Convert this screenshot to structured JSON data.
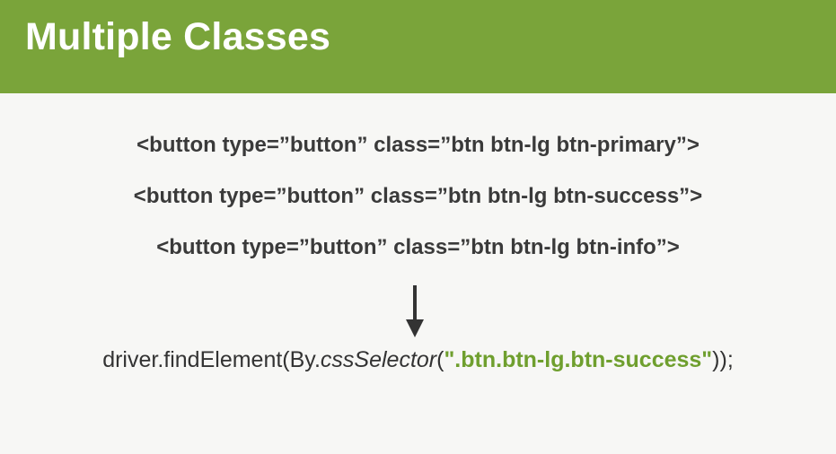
{
  "header": {
    "title": "Multiple Classes",
    "background_color": "#7aa43a"
  },
  "code_lines": [
    "<button type=”button” class=”btn btn-lg btn-primary”>",
    "<button type=”button” class=”btn btn-lg btn-success”>",
    "<button type=”button” class=”btn btn-lg btn-info”>"
  ],
  "arrow": {
    "icon": "down-arrow-icon"
  },
  "selector": {
    "prefix": "driver.findElement(By.",
    "method": "cssSelector",
    "open_paren": "(",
    "value": "\".btn.btn-lg.btn-success\"",
    "suffix": "));",
    "accent_color": "#6f9f2e"
  }
}
